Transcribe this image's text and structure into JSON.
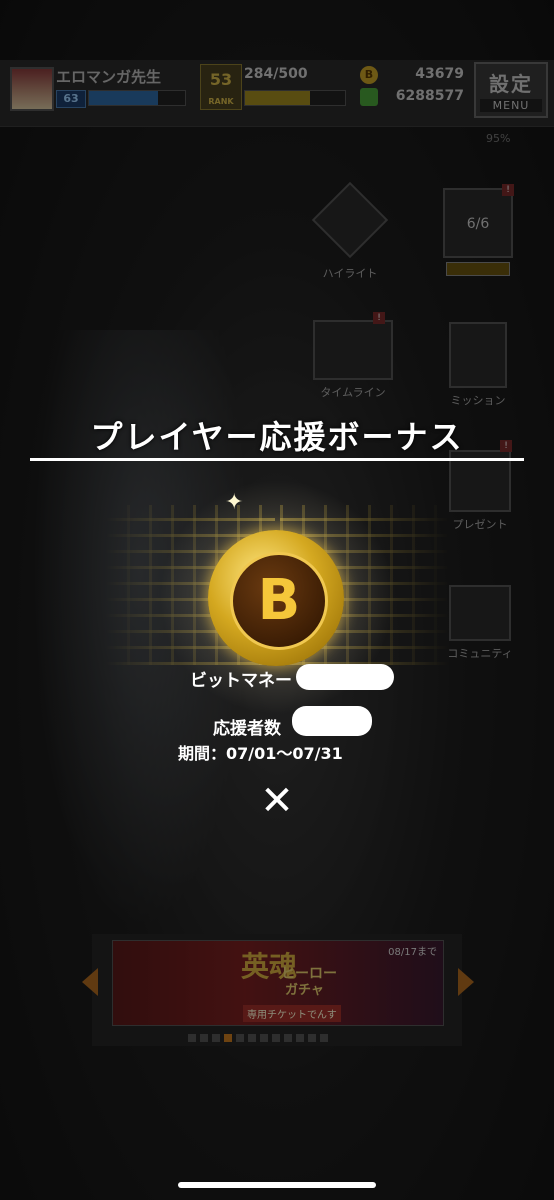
{
  "header": {
    "player_name": "エロマンガ先生",
    "player_level": "63",
    "exp_fill": 0.72,
    "rank_value": "53",
    "rank_label": "RANK",
    "stamina": "284/500",
    "stamina_fill": 0.65,
    "coins": "43679",
    "gems": "6288577",
    "menu_jp": "設定",
    "menu_en": "MENU",
    "battery": "95%"
  },
  "side_menu": {
    "highlight": "ハイライト",
    "timeline": "タイムライン",
    "mission": "ミッション",
    "present": "プレゼント",
    "community": "コミュニティ",
    "counter": "6/6"
  },
  "dialog": {
    "title": "プレイヤー応援ボーナス",
    "coin_letter": "B",
    "reward_label": "ビットマネー",
    "supporters_label": "応援者数",
    "period": "期間：07/01～07/31",
    "close_symbol": "✕"
  },
  "banner": {
    "kanji": "英魂",
    "title_line1": "ヒーロー",
    "title_line2": "ガチャ",
    "subtitle": "専用チケットでんす",
    "date": "08/17まで",
    "page_count": 12,
    "active_page": 3
  },
  "colors": {
    "gold": "#d4a820",
    "accent_orange": "#c87a20"
  }
}
